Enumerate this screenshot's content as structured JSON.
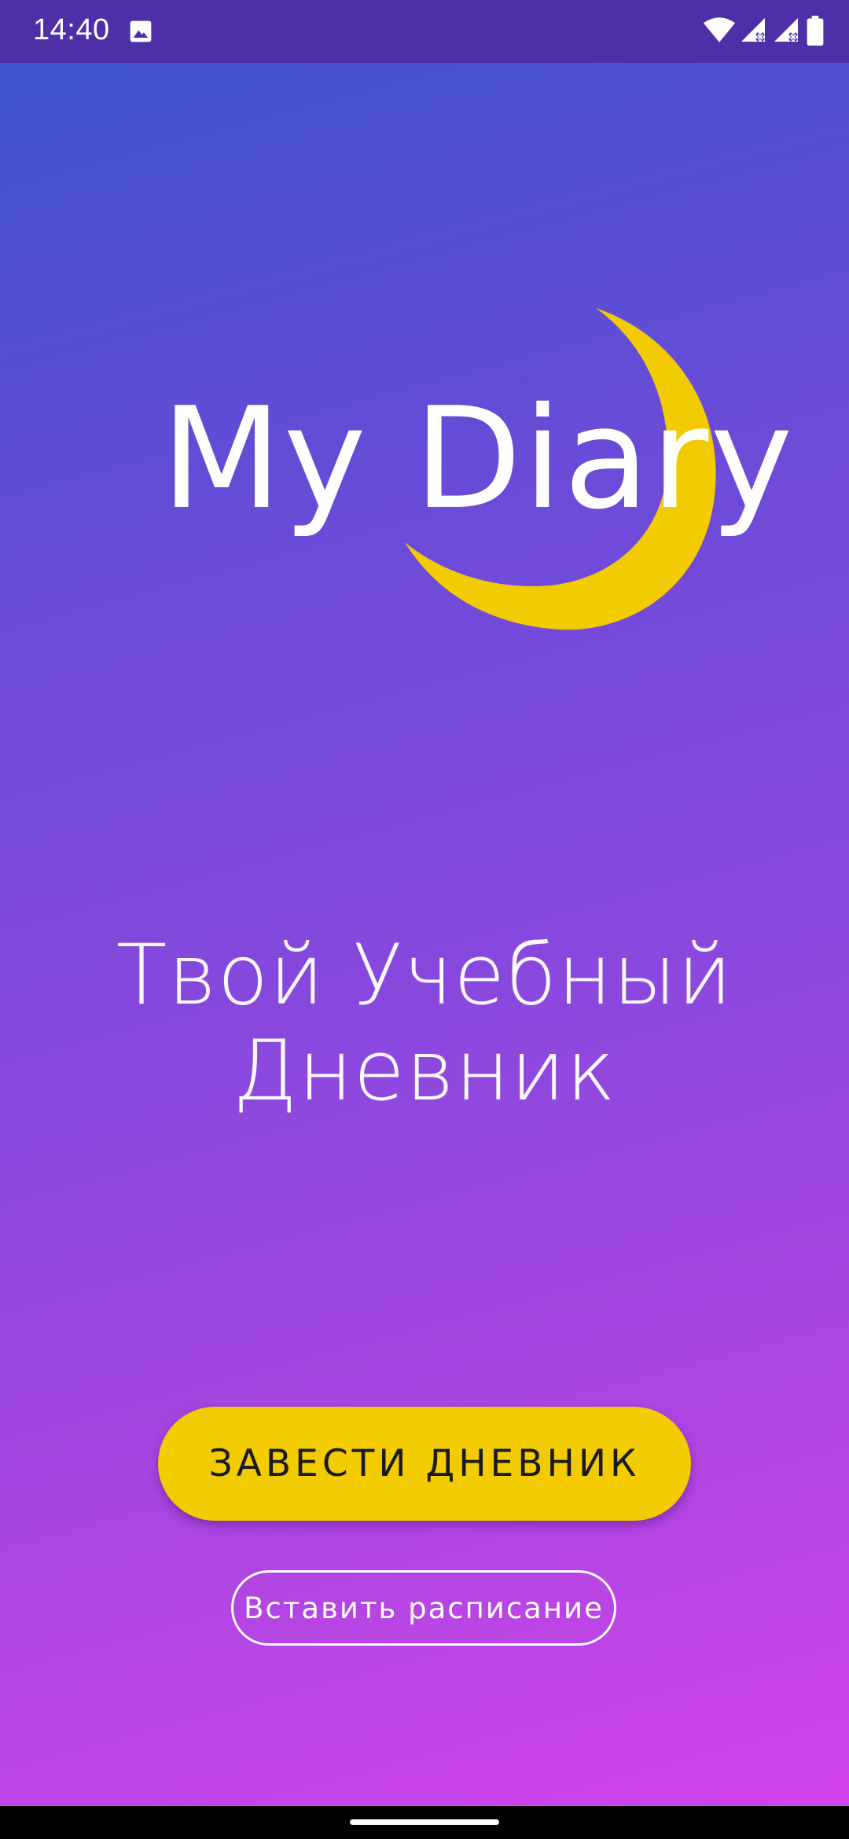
{
  "status_bar": {
    "time": "14:40",
    "icons": [
      "image-icon",
      "wifi-icon",
      "signal-icon",
      "signal-icon",
      "battery-icon"
    ]
  },
  "logo": {
    "text": "My Diary",
    "moon_icon": "crescent-moon-icon"
  },
  "tagline": {
    "line1": "Твой Учебный",
    "line2": "Дневник"
  },
  "buttons": {
    "create_diary": "ЗАВЕСТИ ДНЕВНИК",
    "insert_schedule": "Вставить расписание"
  },
  "colors": {
    "accent_yellow": "#f2cc00",
    "status_bar": "#4e2fa8",
    "gradient_top": "#3a55cc",
    "gradient_bottom": "#d444ea"
  }
}
